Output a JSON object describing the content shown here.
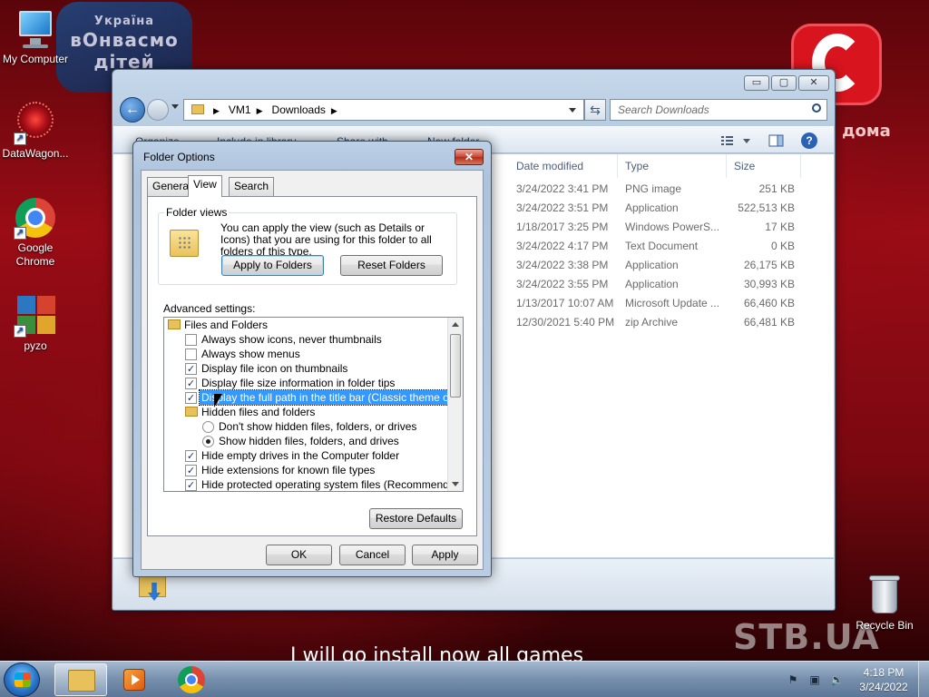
{
  "wallpaper": {
    "badge_line1": "Україна",
    "badge_line2": "вОнвасмо",
    "badge_line3": "дітей",
    "doma": "дома",
    "stb": "STB.UA",
    "subtitle": "I will go install now all games"
  },
  "desktop_icons": [
    {
      "label": "My Computer",
      "icon": "computer-icon"
    },
    {
      "label": "DataWagon...",
      "icon": "datawagon-icon"
    },
    {
      "label": "Google Chrome",
      "icon": "chrome-icon"
    },
    {
      "label": "pyzo",
      "icon": "pyzo-icon"
    },
    {
      "label": "Recycle Bin",
      "icon": "recycle-bin-icon"
    }
  ],
  "explorer": {
    "title_buttons": {
      "minimize": "▭",
      "maximize": "▢",
      "close": "✕"
    },
    "breadcrumb": [
      "VM1",
      "Downloads"
    ],
    "search_placeholder": "Search Downloads",
    "toolbar": {
      "organize": "Organize",
      "include": "Include in library",
      "share": "Share with",
      "new_folder": "New folder"
    },
    "columns": [
      "Date modified",
      "Type",
      "Size"
    ],
    "files": [
      {
        "date": "3/24/2022 3:41 PM",
        "type": "PNG image",
        "size": "251 KB"
      },
      {
        "date": "3/24/2022 3:51 PM",
        "type": "Application",
        "size": "522,513 KB"
      },
      {
        "date": "1/18/2017 3:25 PM",
        "type": "Windows PowerS...",
        "size": "17 KB"
      },
      {
        "date": "3/24/2022 4:17 PM",
        "type": "Text Document",
        "size": "0 KB"
      },
      {
        "date": "3/24/2022 3:38 PM",
        "type": "Application",
        "size": "26,175 KB"
      },
      {
        "date": "3/24/2022 3:55 PM",
        "type": "Application",
        "size": "30,993 KB"
      },
      {
        "date": "1/13/2017 10:07 AM",
        "type": "Microsoft Update ...",
        "size": "66,460 KB"
      },
      {
        "date": "12/30/2021 5:40 PM",
        "type": "zip Archive",
        "size": "66,481 KB"
      }
    ]
  },
  "dialog": {
    "title": "Folder Options",
    "close": "✕",
    "tabs": [
      "General",
      "View",
      "Search"
    ],
    "active_tab": "View",
    "folder_views": {
      "label": "Folder views",
      "text": "You can apply the view (such as Details or Icons) that you are using for this folder to all folders of this type.",
      "apply_button": "Apply to Folders",
      "reset_button": "Reset Folders"
    },
    "advanced_label": "Advanced settings:",
    "tree": [
      {
        "kind": "folder",
        "label": "Files and Folders"
      },
      {
        "kind": "check",
        "label": "Always show icons, never thumbnails",
        "checked": false
      },
      {
        "kind": "check",
        "label": "Always show menus",
        "checked": false
      },
      {
        "kind": "check",
        "label": "Display file icon on thumbnails",
        "checked": true
      },
      {
        "kind": "check",
        "label": "Display file size information in folder tips",
        "checked": true
      },
      {
        "kind": "check",
        "label": "Display the full path in the title bar (Classic theme only)",
        "checked": true,
        "selected": true
      },
      {
        "kind": "subfolder",
        "label": "Hidden files and folders"
      },
      {
        "kind": "radio",
        "label": "Don't show hidden files, folders, or drives",
        "checked": false
      },
      {
        "kind": "radio",
        "label": "Show hidden files, folders, and drives",
        "checked": true
      },
      {
        "kind": "check",
        "label": "Hide empty drives in the Computer folder",
        "checked": true
      },
      {
        "kind": "check",
        "label": "Hide extensions for known file types",
        "checked": true
      },
      {
        "kind": "check",
        "label": "Hide protected operating system files (Recommended)",
        "checked": true
      }
    ],
    "restore_button": "Restore Defaults",
    "ok_button": "OK",
    "cancel_button": "Cancel",
    "apply_button": "Apply"
  },
  "taskbar": {
    "clock_time": "4:18 PM",
    "clock_date": "3/24/2022"
  }
}
